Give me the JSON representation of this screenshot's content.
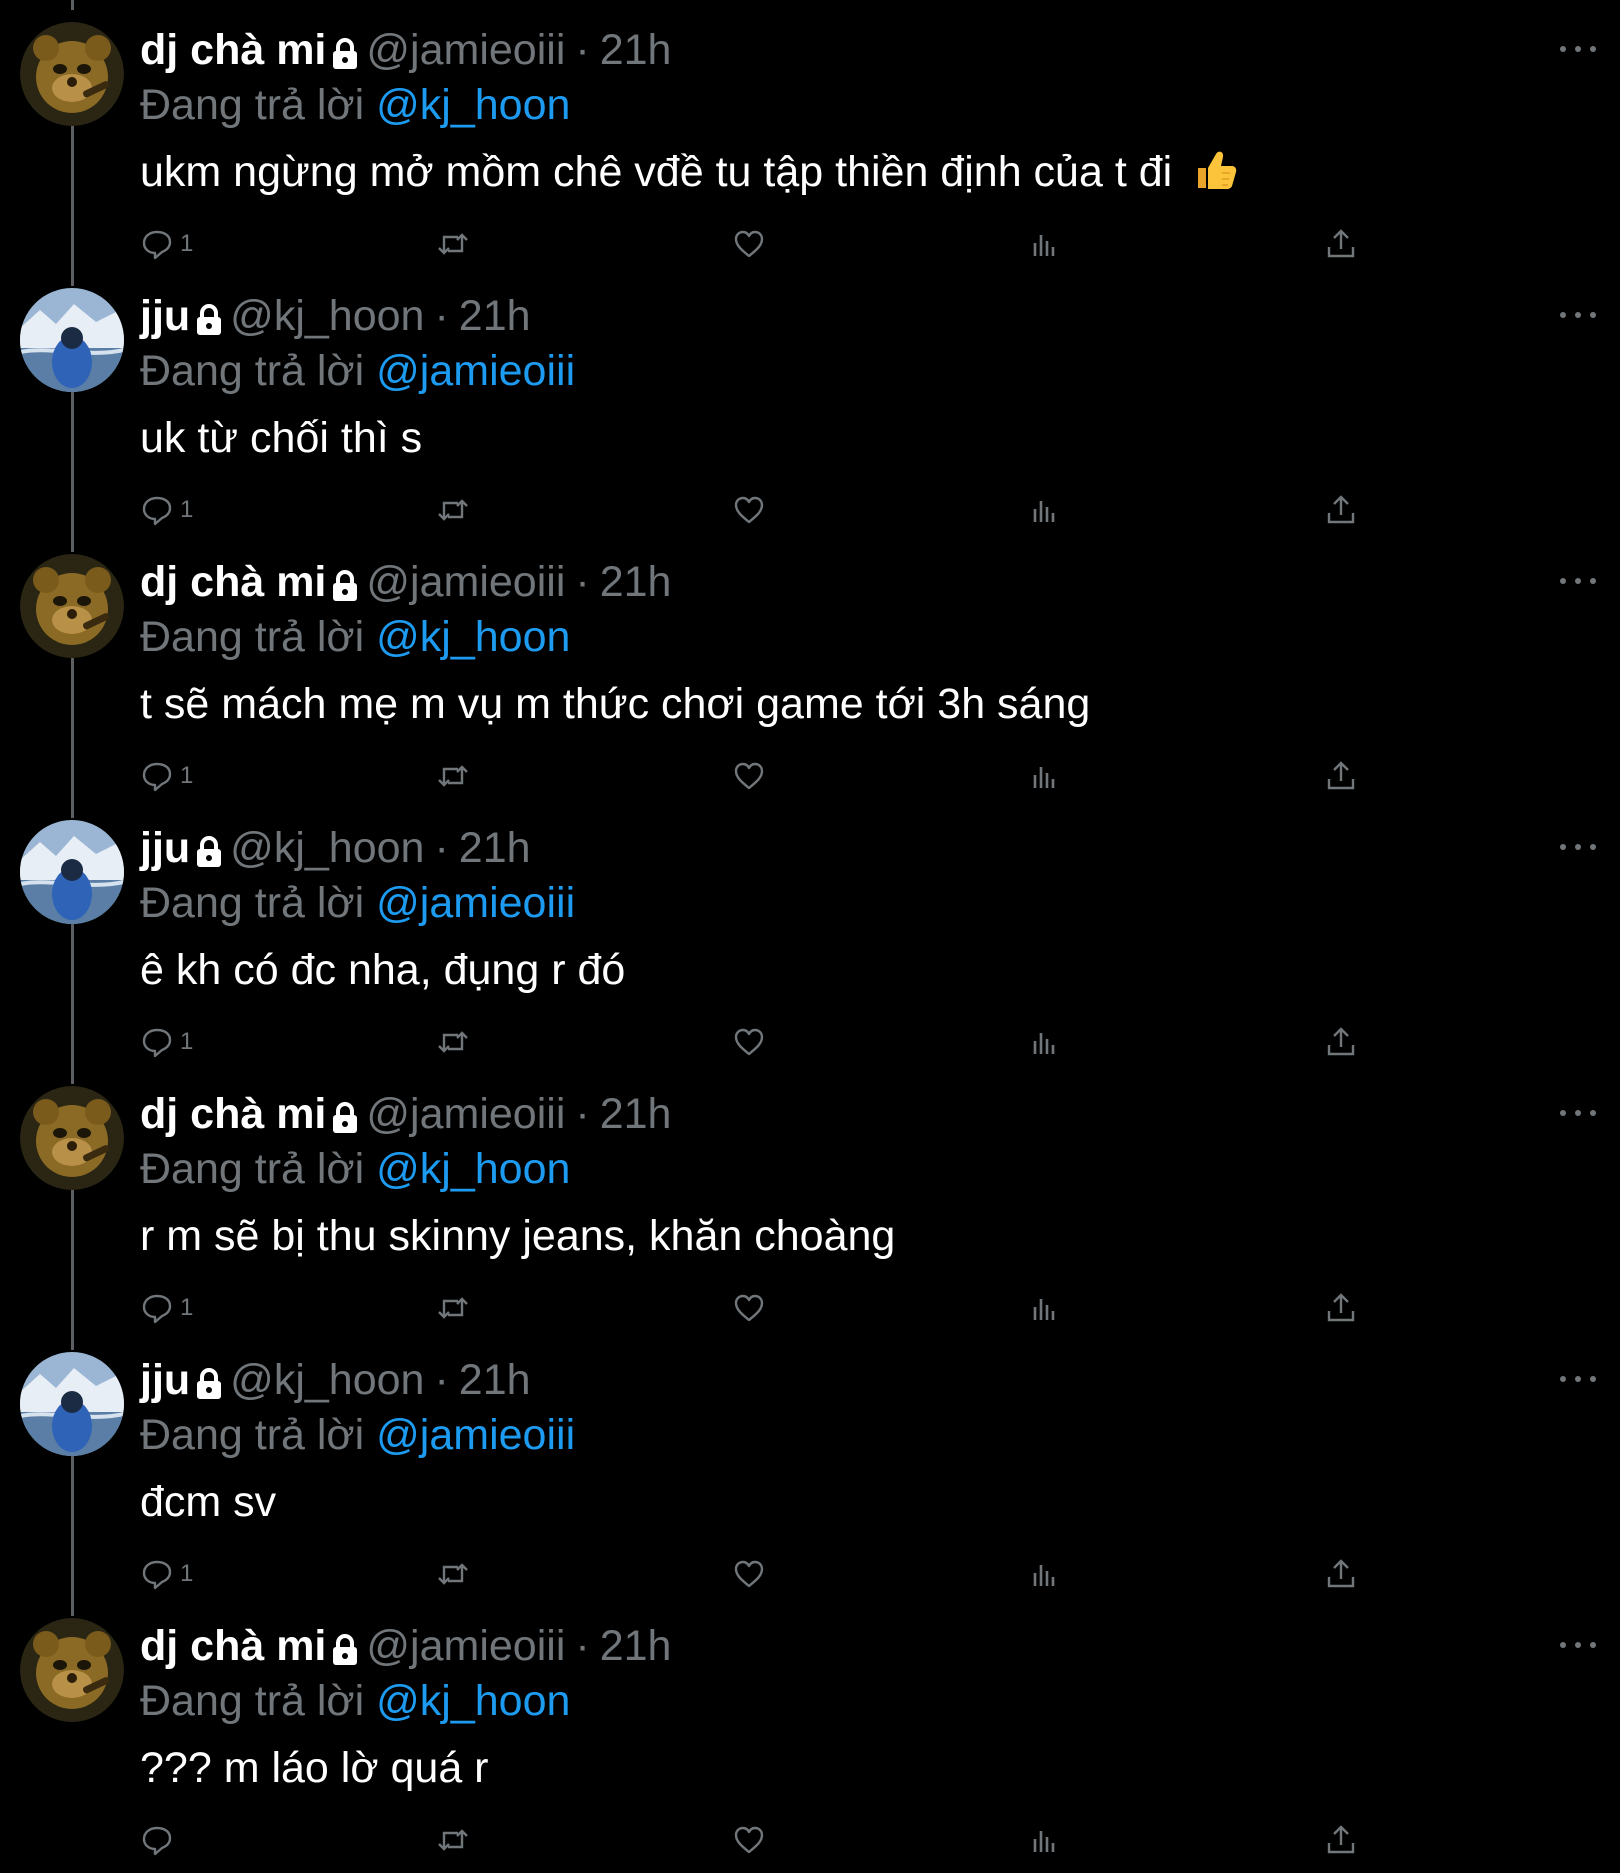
{
  "colors": {
    "background": "#000000",
    "text": "#ffffff",
    "muted": "#71767b",
    "link": "#1d9bf0",
    "thread_line": "#5b5f64"
  },
  "users": {
    "jamie": {
      "display_name": "dj chà mi",
      "handle": "@jamieoiii",
      "avatar_icon": "bear-avatar-icon"
    },
    "hoon": {
      "display_name": "jju",
      "handle": "@kj_hoon",
      "avatar_icon": "snow-landscape-avatar-icon"
    }
  },
  "icons": {
    "lock": "lock-icon",
    "more": "more-icon",
    "reply": "reply-icon",
    "retweet": "retweet-icon",
    "like": "heart-icon",
    "views": "views-icon",
    "share": "share-icon",
    "thumbs_up": "thumbs-up-emoji-icon"
  },
  "tweets": [
    {
      "display_name": "dj chà mi",
      "handle": "@jamieoiii",
      "dot": "·",
      "time": "21h",
      "reply_prefix": "Đang trả lời",
      "reply_to": "@kj_hoon",
      "text": "ukm ngừng mở mồm chê vđề tu tập thiền định của t đi",
      "reply_count": "1"
    },
    {
      "display_name": "jju",
      "handle": "@kj_hoon",
      "dot": "·",
      "time": "21h",
      "reply_prefix": "Đang trả lời",
      "reply_to": "@jamieoiii",
      "text": "uk từ chối thì s",
      "reply_count": "1"
    },
    {
      "display_name": "dj chà mi",
      "handle": "@jamieoiii",
      "dot": "·",
      "time": "21h",
      "reply_prefix": "Đang trả lời",
      "reply_to": "@kj_hoon",
      "text": "t sẽ mách mẹ m vụ m thức chơi game tới 3h sáng",
      "reply_count": "1"
    },
    {
      "display_name": "jju",
      "handle": "@kj_hoon",
      "dot": "·",
      "time": "21h",
      "reply_prefix": "Đang trả lời",
      "reply_to": "@jamieoiii",
      "text": "ê kh có đc nha, đụng r đó",
      "reply_count": "1"
    },
    {
      "display_name": "dj chà mi",
      "handle": "@jamieoiii",
      "dot": "·",
      "time": "21h",
      "reply_prefix": "Đang trả lời",
      "reply_to": "@kj_hoon",
      "text": "r m sẽ bị thu skinny jeans, khăn choàng",
      "reply_count": "1"
    },
    {
      "display_name": "jju",
      "handle": "@kj_hoon",
      "dot": "·",
      "time": "21h",
      "reply_prefix": "Đang trả lời",
      "reply_to": "@jamieoiii",
      "text": "đcm sv",
      "reply_count": "1"
    },
    {
      "display_name": "dj chà mi",
      "handle": "@jamieoiii",
      "dot": "·",
      "time": "21h",
      "reply_prefix": "Đang trả lời",
      "reply_to": "@kj_hoon",
      "text": "??? m láo lờ quá r",
      "reply_count": ""
    }
  ]
}
